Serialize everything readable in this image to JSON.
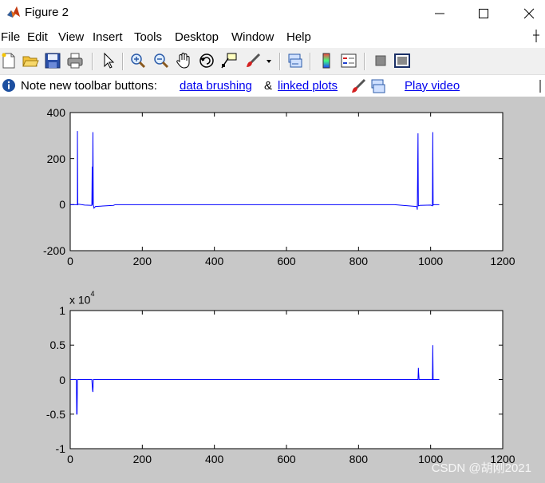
{
  "window": {
    "title": "Figure 2",
    "icon": "matlab-logo-icon"
  },
  "menu": {
    "items": [
      "File",
      "Edit",
      "View",
      "Insert",
      "Tools",
      "Desktop",
      "Window",
      "Help"
    ]
  },
  "toolbar": {
    "buttons": [
      "new-figure-icon",
      "open-file-icon",
      "save-icon",
      "print-icon",
      "edit-plot-arrow-icon",
      "zoom-in-icon",
      "zoom-out-icon",
      "pan-hand-icon",
      "rotate-3d-icon",
      "data-cursor-icon",
      "brush-icon",
      "brush-dropdown-icon",
      "link-plot-icon",
      "colorbar-icon",
      "legend-icon",
      "hide-plot-tools-icon",
      "show-plot-tools-icon"
    ]
  },
  "notice": {
    "text_prefix": "Note new toolbar buttons:",
    "link_brushing": "data brushing",
    "amp": "&",
    "link_linked": "linked plots",
    "link_video": "Play video"
  },
  "watermark": "CSDN @胡刚2021",
  "colors": {
    "series": "#0000ff",
    "figure_bg": "#c8c8c8",
    "link": "#0000ee"
  },
  "chart_data": [
    {
      "type": "line",
      "xlim": [
        0,
        1200
      ],
      "ylim": [
        -200,
        400
      ],
      "xticks": [
        "0",
        "200",
        "400",
        "600",
        "800",
        "1000",
        "1200"
      ],
      "yticks": [
        "400",
        "200",
        "0",
        "-200"
      ],
      "grid": false,
      "series": [
        {
          "color": "#0000ff",
          "x": [
            0,
            15,
            20,
            20,
            21,
            23,
            40,
            60,
            61,
            62,
            63,
            64,
            66,
            70,
            120,
            125,
            900,
            960,
            962,
            963,
            964,
            965,
            966,
            970,
            1000,
            1005,
            1006,
            1007,
            1010,
            1024
          ],
          "y": [
            0,
            0,
            0,
            320,
            0,
            2,
            -2,
            -3,
            165,
            0,
            315,
            0,
            -15,
            -8,
            -3,
            0,
            0,
            -8,
            -10,
            -22,
            140,
            310,
            -5,
            -3,
            -2,
            -5,
            315,
            -2,
            0,
            0
          ]
        }
      ]
    },
    {
      "type": "line",
      "xlim": [
        0,
        1200
      ],
      "ylim": [
        -1,
        1
      ],
      "exponent": "x 10",
      "exponent_power": "4",
      "xticks": [
        "0",
        "200",
        "400",
        "600",
        "800",
        "1000",
        "1200"
      ],
      "yticks": [
        "1",
        "0.5",
        "0",
        "-0.5",
        "-1"
      ],
      "grid": false,
      "series": [
        {
          "color": "#0000ff",
          "x": [
            0,
            15,
            17,
            18,
            19,
            20,
            22,
            60,
            61,
            62,
            63,
            64,
            66,
            965,
            966,
            967,
            968,
            1000,
            1005,
            1006,
            1007,
            1010,
            1024
          ],
          "y": [
            0,
            0,
            0,
            -0.5,
            -0.5,
            0,
            0,
            0,
            -0.08,
            -0.15,
            -0.18,
            0,
            0,
            0,
            0.17,
            0.08,
            0,
            0,
            0,
            0.5,
            0,
            0,
            0
          ]
        }
      ]
    }
  ]
}
